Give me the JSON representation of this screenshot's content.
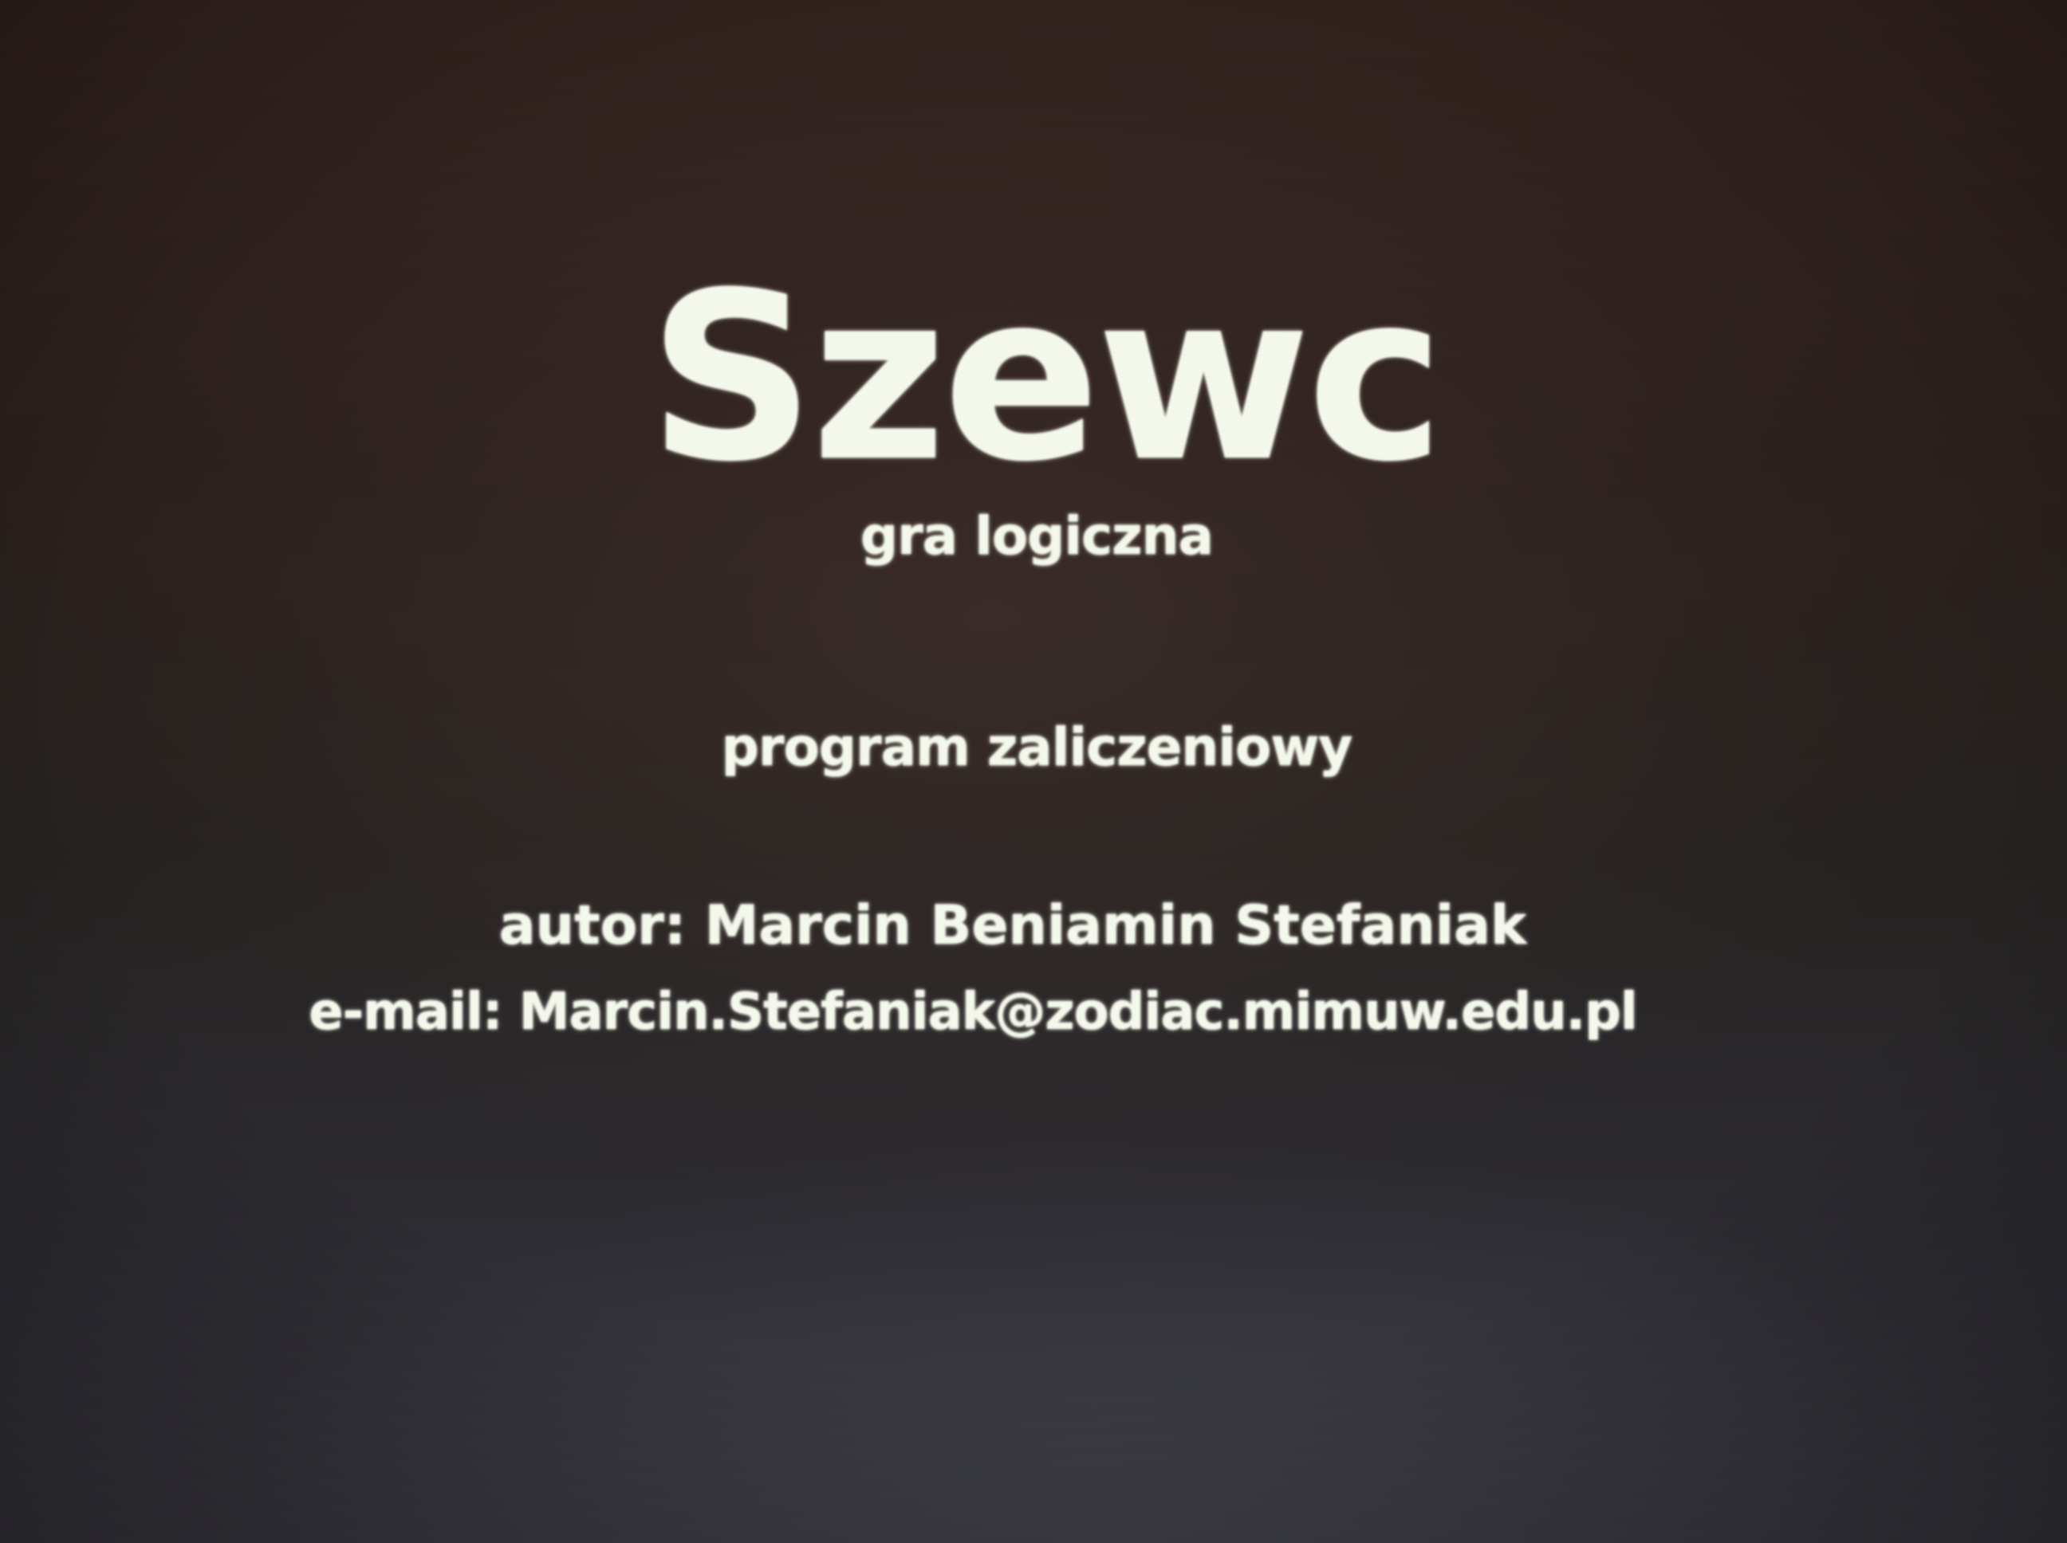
{
  "splash": {
    "title": "Szewc",
    "subtitle": "gra logiczna",
    "program_note": "program zaliczeniowy",
    "author_line": "autor: Marcin Beniamin Stefaniak",
    "email_line": "e-mail: Marcin.Stefaniak@zodiac.mimuw.edu.pl"
  },
  "colors": {
    "text": "#f4f8ec",
    "background": "#2a211e"
  }
}
